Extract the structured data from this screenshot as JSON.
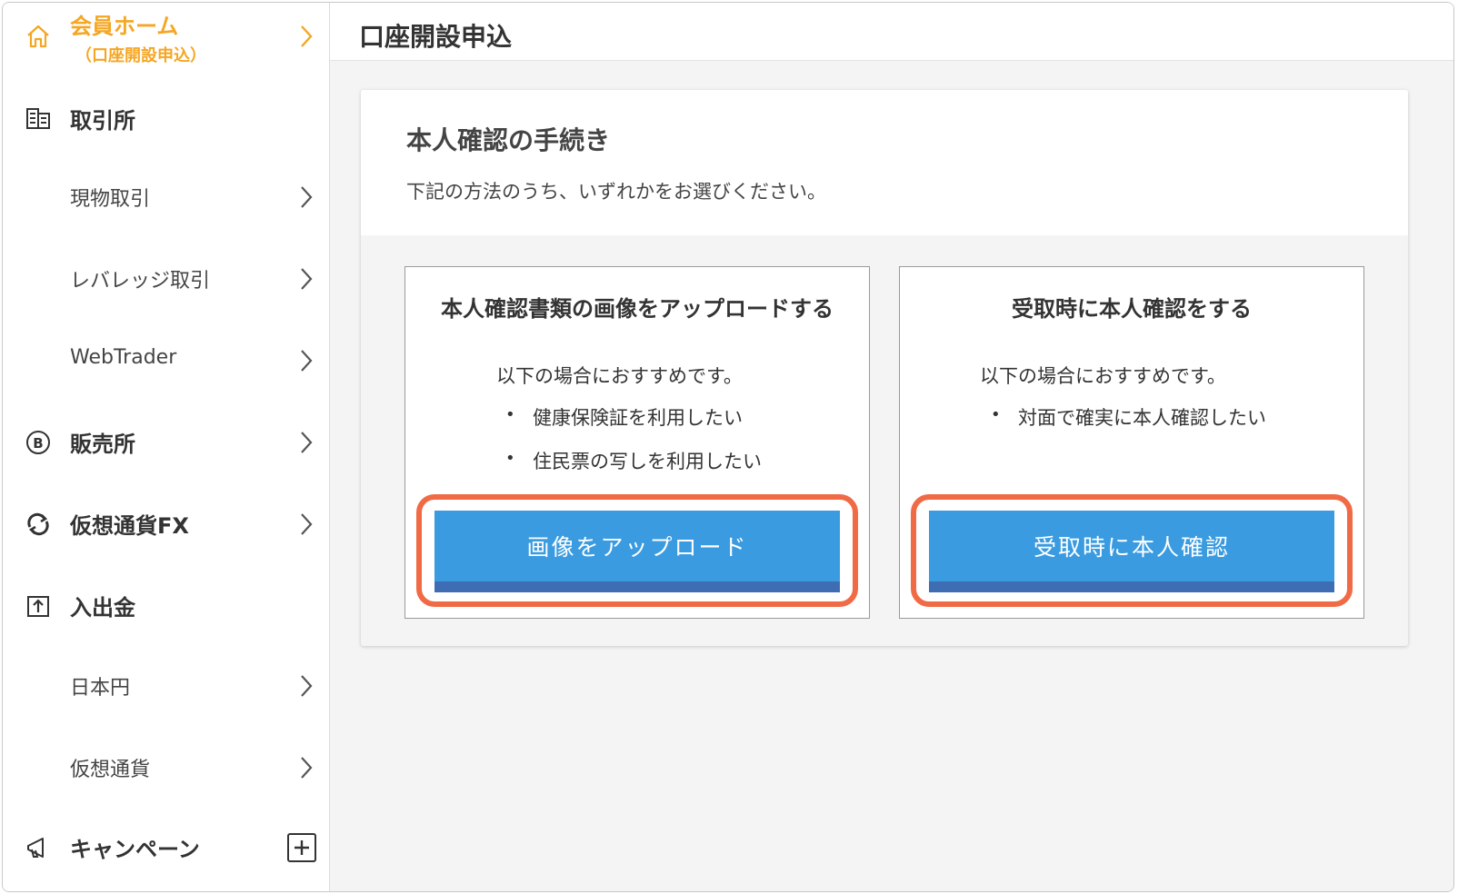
{
  "sidebar": {
    "home": {
      "title": "会員ホーム",
      "subtitle": "（口座開設申込）"
    },
    "exchange": {
      "label": "取引所"
    },
    "spot": {
      "label": "現物取引"
    },
    "leverage": {
      "label": "レバレッジ取引"
    },
    "webtrader": {
      "label": "WebTrader"
    },
    "shop": {
      "label": "販売所"
    },
    "fx": {
      "label": "仮想通貨FX"
    },
    "deposit": {
      "label": "入出金"
    },
    "jpy": {
      "label": "日本円"
    },
    "crypto": {
      "label": "仮想通貨"
    },
    "campaign": {
      "label": "キャンペーン"
    }
  },
  "main": {
    "page_title": "口座開設申込",
    "card": {
      "title": "本人確認の手続き",
      "description": "下記の方法のうち、いずれかをお選びください。",
      "options": [
        {
          "title": "本人確認書類の画像をアップロードする",
          "lead": "以下の場合におすすめです。",
          "bullets": [
            "健康保険証を利用したい",
            "住民票の写しを利用したい"
          ],
          "button": "画像をアップロード"
        },
        {
          "title": "受取時に本人確認をする",
          "lead": "以下の場合におすすめです。",
          "bullets": [
            "対面で確実に本人確認したい"
          ],
          "button": "受取時に本人確認"
        }
      ]
    }
  },
  "colors": {
    "accent_orange": "#f5a623",
    "button_blue": "#3a9be0",
    "button_shadow": "#3f6db3",
    "highlight_ring": "#f06a45"
  }
}
